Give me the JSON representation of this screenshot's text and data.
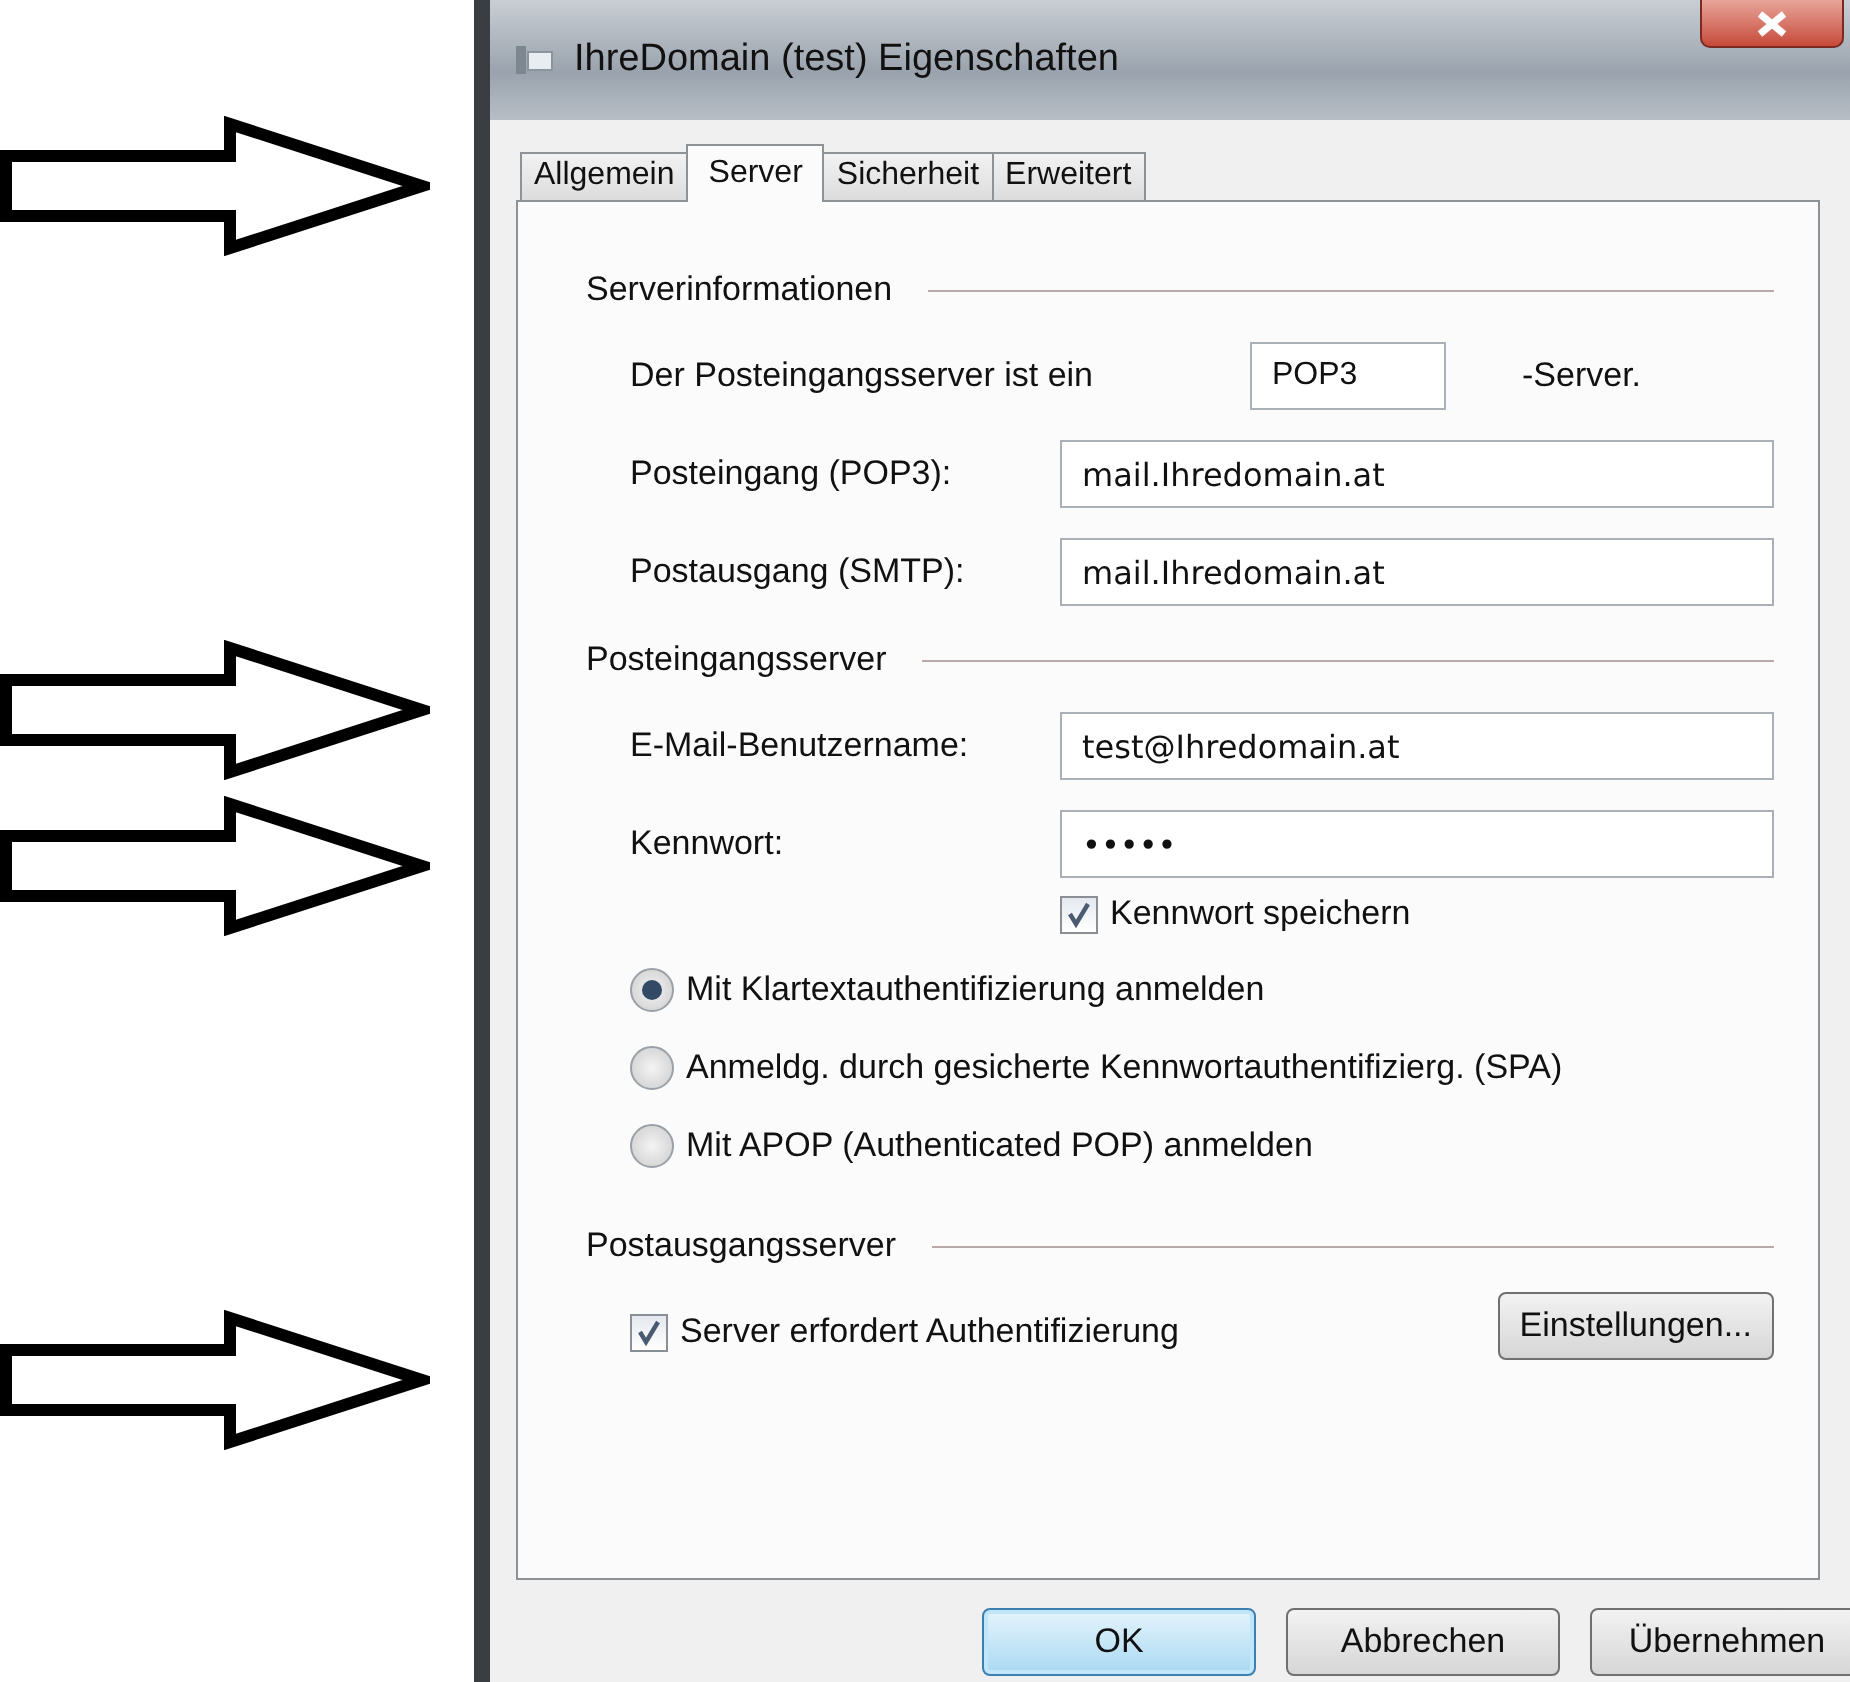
{
  "window": {
    "title": "IhreDomain (test) Eigenschaften"
  },
  "tabs": [
    {
      "label": "Allgemein",
      "selected": false
    },
    {
      "label": "Server",
      "selected": true
    },
    {
      "label": "Sicherheit",
      "selected": false
    },
    {
      "label": "Erweitert",
      "selected": false
    }
  ],
  "sections": [
    {
      "title": "Serverinformationen",
      "rows": [
        {
          "kind": "server-type",
          "label": "Der Posteingangsserver ist ein",
          "value": "POP3",
          "suffix": "-Server."
        },
        {
          "kind": "field",
          "label": "Posteingang (POP3):",
          "value": "mail.Ihredomain.at"
        },
        {
          "kind": "field",
          "label": "Postausgang (SMTP):",
          "value": "mail.Ihredomain.at"
        }
      ]
    },
    {
      "title": "Posteingangsserver",
      "rows": [
        {
          "kind": "field",
          "label": "E-Mail-Benutzername:",
          "value": "test@Ihredomain.at"
        },
        {
          "kind": "field",
          "label": "Kennwort:",
          "value": "•••••"
        },
        {
          "kind": "field-checkbox",
          "label": "Kennwort speichern",
          "checked": true
        },
        {
          "kind": "radio",
          "label": "Mit Klartextauthentifizierung anmelden",
          "selected": true
        },
        {
          "kind": "radio",
          "label": "Anmeldg. durch gesicherte Kennwortauthentifizierg. (SPA)",
          "selected": false
        },
        {
          "kind": "radio",
          "label": "Mit APOP (Authenticated POP) anmelden",
          "selected": false
        }
      ]
    },
    {
      "title": "Postausgangsserver",
      "rows": [
        {
          "kind": "checkbox-button",
          "label": "Server erfordert Authentifizierung",
          "checked": true,
          "button": "Einstellungen..."
        }
      ]
    }
  ],
  "buttons": [
    {
      "label": "OK",
      "default": true
    },
    {
      "label": "Abbrechen",
      "default": false
    },
    {
      "label": "Übernehmen",
      "default": false
    }
  ]
}
